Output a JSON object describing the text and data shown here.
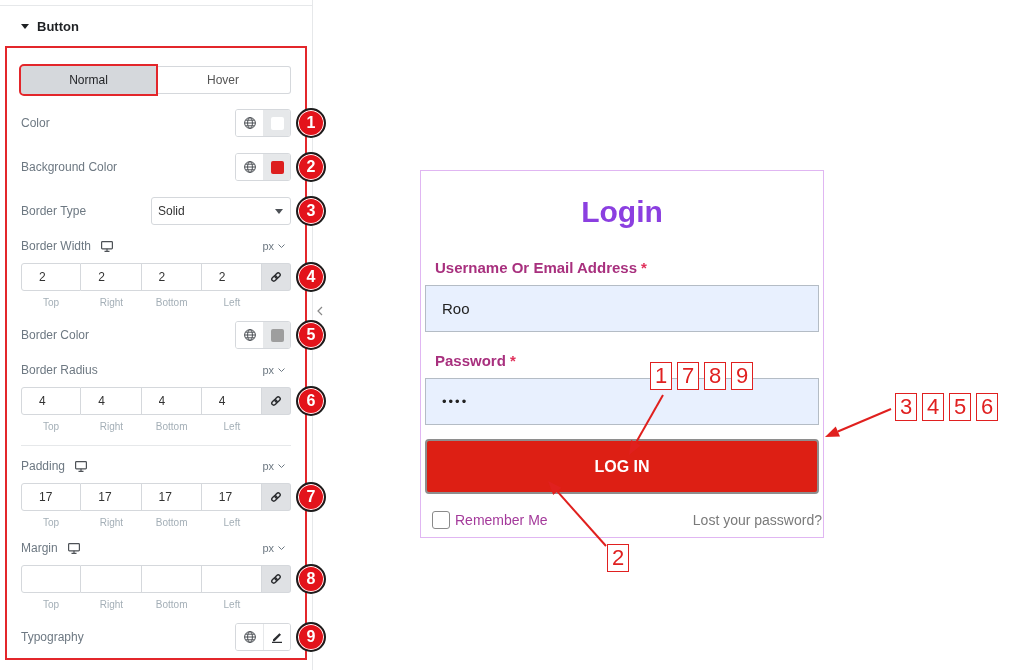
{
  "panel": {
    "section": {
      "title": "Button",
      "expanded": true
    },
    "tabs": [
      {
        "label": "Normal",
        "selected": true,
        "highlighted": true
      },
      {
        "label": "Hover",
        "selected": false,
        "highlighted": false
      }
    ],
    "controls": [
      {
        "kind": "color",
        "label": "Color",
        "color": "#ffffff",
        "badge": "1"
      },
      {
        "kind": "color",
        "label": "Background Color",
        "color": "#dd1f1f",
        "badge": "2"
      },
      {
        "kind": "select",
        "label": "Border Type",
        "value": "Solid",
        "badge": "3"
      },
      {
        "kind": "dimensions",
        "label": "Border Width",
        "responsive": true,
        "unit": "px",
        "linked": true,
        "badge": "4",
        "fields": [
          {
            "side": "Top",
            "value": "2"
          },
          {
            "side": "Right",
            "value": "2"
          },
          {
            "side": "Bottom",
            "value": "2"
          },
          {
            "side": "Left",
            "value": "2"
          }
        ]
      },
      {
        "kind": "color",
        "label": "Border Color",
        "color": "#9e9e9e",
        "badge": "5"
      },
      {
        "kind": "dimensions",
        "label": "Border Radius",
        "responsive": false,
        "unit": "px",
        "linked": true,
        "badge": "6",
        "fields": [
          {
            "side": "Top",
            "value": "4"
          },
          {
            "side": "Right",
            "value": "4"
          },
          {
            "side": "Bottom",
            "value": "4"
          },
          {
            "side": "Left",
            "value": "4"
          }
        ]
      },
      {
        "kind": "divider"
      },
      {
        "kind": "dimensions",
        "label": "Padding",
        "responsive": true,
        "unit": "px",
        "linked": true,
        "badge": "7",
        "fields": [
          {
            "side": "Top",
            "value": "17"
          },
          {
            "side": "Right",
            "value": "17"
          },
          {
            "side": "Bottom",
            "value": "17"
          },
          {
            "side": "Left",
            "value": "17"
          }
        ]
      },
      {
        "kind": "dimensions",
        "label": "Margin",
        "responsive": true,
        "unit": "px",
        "linked": true,
        "badge": "8",
        "fields": [
          {
            "side": "Top"
          },
          {
            "side": "Right"
          },
          {
            "side": "Bottom"
          },
          {
            "side": "Left"
          }
        ]
      },
      {
        "kind": "typography",
        "label": "Typography",
        "badge": "9"
      }
    ]
  },
  "login_form": {
    "title": "Login",
    "fields": [
      {
        "kind": "text",
        "label": "Username Or Email Address",
        "required_mark": "*",
        "value": "Roo"
      },
      {
        "kind": "password",
        "label": "Password",
        "required_mark": "*",
        "value": "••••"
      }
    ],
    "submit": "LOG IN",
    "remember": {
      "label": "Remember Me",
      "checked": false
    },
    "lost_password": "Lost your password?"
  },
  "callouts": [
    {
      "numbers": [
        "1",
        "7",
        "8",
        "9"
      ]
    },
    {
      "numbers": [
        "3",
        "4",
        "5",
        "6"
      ]
    },
    {
      "numbers": [
        "2"
      ]
    }
  ]
}
